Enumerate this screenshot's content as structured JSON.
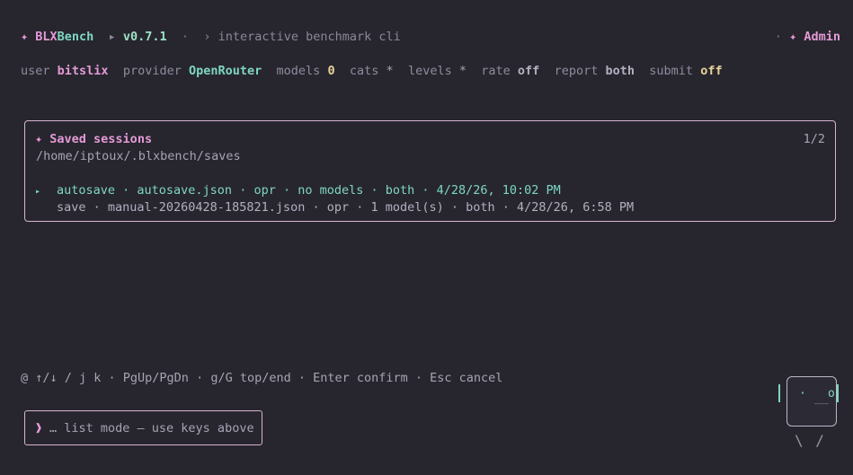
{
  "header": {
    "star": "✦",
    "brand_a": "BLX",
    "brand_b": "Bench",
    "arrow": "▸",
    "version": "v0.7.1",
    "dot": "·",
    "chevron": "›",
    "subtitle": "interactive benchmark cli",
    "admin_dot": "·",
    "admin_star": "✦",
    "admin_label": "Admin"
  },
  "status": {
    "user_key": "user",
    "user_val": "bitslix",
    "provider_key": "provider",
    "provider_val": "OpenRouter",
    "models_key": "models",
    "models_val": "0",
    "cats_key": "cats",
    "cats_val": "*",
    "levels_key": "levels",
    "levels_val": "*",
    "rate_key": "rate",
    "rate_val": "off",
    "report_key": "report",
    "report_val": "both",
    "submit_key": "submit",
    "submit_val": "off"
  },
  "sessions": {
    "star": "✦",
    "title": "Saved sessions",
    "count": "1/2",
    "path": "/home/iptoux/.blxbench/saves",
    "items": [
      {
        "marker": "▸",
        "text": "autosave · autosave.json · opr · no models · both · 4/28/26, 10:02 PM"
      },
      {
        "marker": "",
        "text": "save · manual-20260428-185821.json · opr · 1 model(s) · both · 4/28/26, 6:58 PM"
      }
    ]
  },
  "hints": "@ ↑/↓ / j k · PgUp/PgDn · g/G top/end · Enter confirm · Esc cancel",
  "input": {
    "icon": "❱",
    "text": "… list mode — use keys above"
  },
  "mascot": {
    "eye_left": "·",
    "mouth": "__",
    "eye_right": "o",
    "legs": "\\ /"
  },
  "colors": {
    "background": "#27262f",
    "accent_pink": "#e59ad6",
    "accent_teal": "#7ed6c2",
    "accent_yellow": "#e8d49a",
    "border": "#d8b4d0"
  }
}
